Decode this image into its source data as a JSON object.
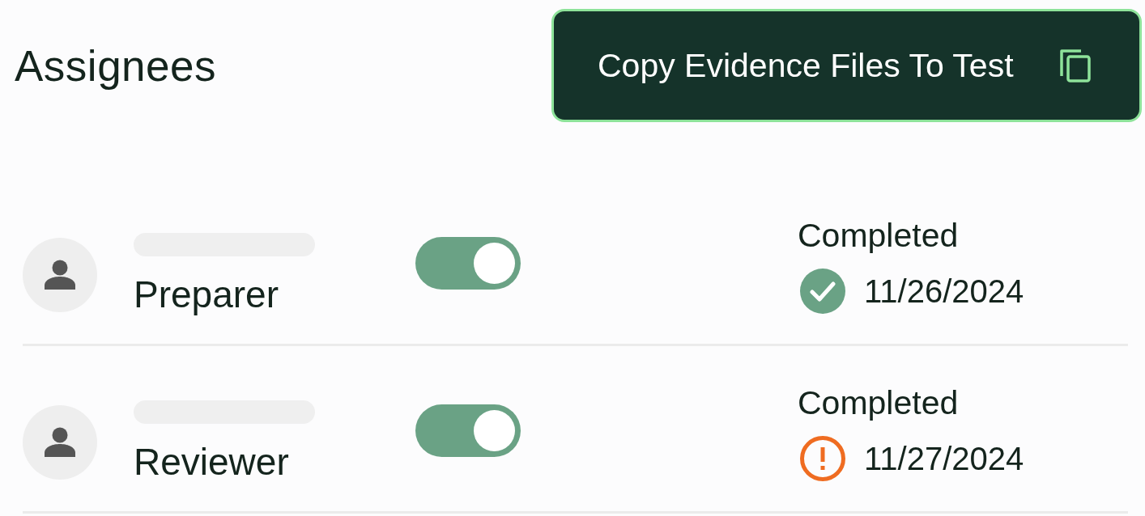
{
  "header": {
    "title": "Assignees",
    "copy_button": {
      "label": "Copy Evidence Files To Test"
    }
  },
  "assignees": [
    {
      "role": "Preparer",
      "enabled": true,
      "status": "Completed",
      "on_time": true,
      "date": "11/26/2024"
    },
    {
      "role": "Reviewer",
      "enabled": true,
      "status": "Completed",
      "on_time": false,
      "date": "11/27/2024"
    }
  ]
}
